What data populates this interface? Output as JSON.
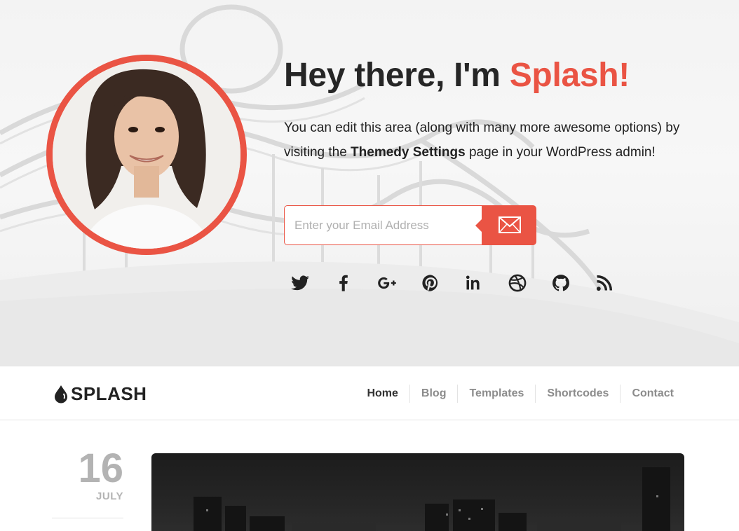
{
  "hero": {
    "title_prefix": "Hey there, I'm ",
    "title_accent": "Splash!",
    "text_before": "You can edit this area (along with many more awesome options) by visiting the ",
    "text_bold": "Themedy Settings",
    "text_after": " page in your WordPress admin!",
    "email_placeholder": "Enter your Email Address",
    "send_icon": "envelope-icon"
  },
  "social": [
    {
      "name": "twitter-icon"
    },
    {
      "name": "facebook-icon"
    },
    {
      "name": "google-plus-icon"
    },
    {
      "name": "pinterest-icon"
    },
    {
      "name": "linkedin-icon"
    },
    {
      "name": "dribbble-icon"
    },
    {
      "name": "github-icon"
    },
    {
      "name": "rss-icon"
    }
  ],
  "nav": {
    "logo": "SPLASH",
    "logo_icon": "drop-icon",
    "items": [
      {
        "label": "Home",
        "active": true
      },
      {
        "label": "Blog",
        "active": false
      },
      {
        "label": "Templates",
        "active": false
      },
      {
        "label": "Shortcodes",
        "active": false
      },
      {
        "label": "Contact",
        "active": false
      }
    ]
  },
  "post": {
    "day": "16",
    "month": "JULY"
  },
  "colors": {
    "accent": "#ea5444",
    "text": "#222222",
    "muted": "#8c8c8c",
    "date": "#b3b3b3"
  }
}
